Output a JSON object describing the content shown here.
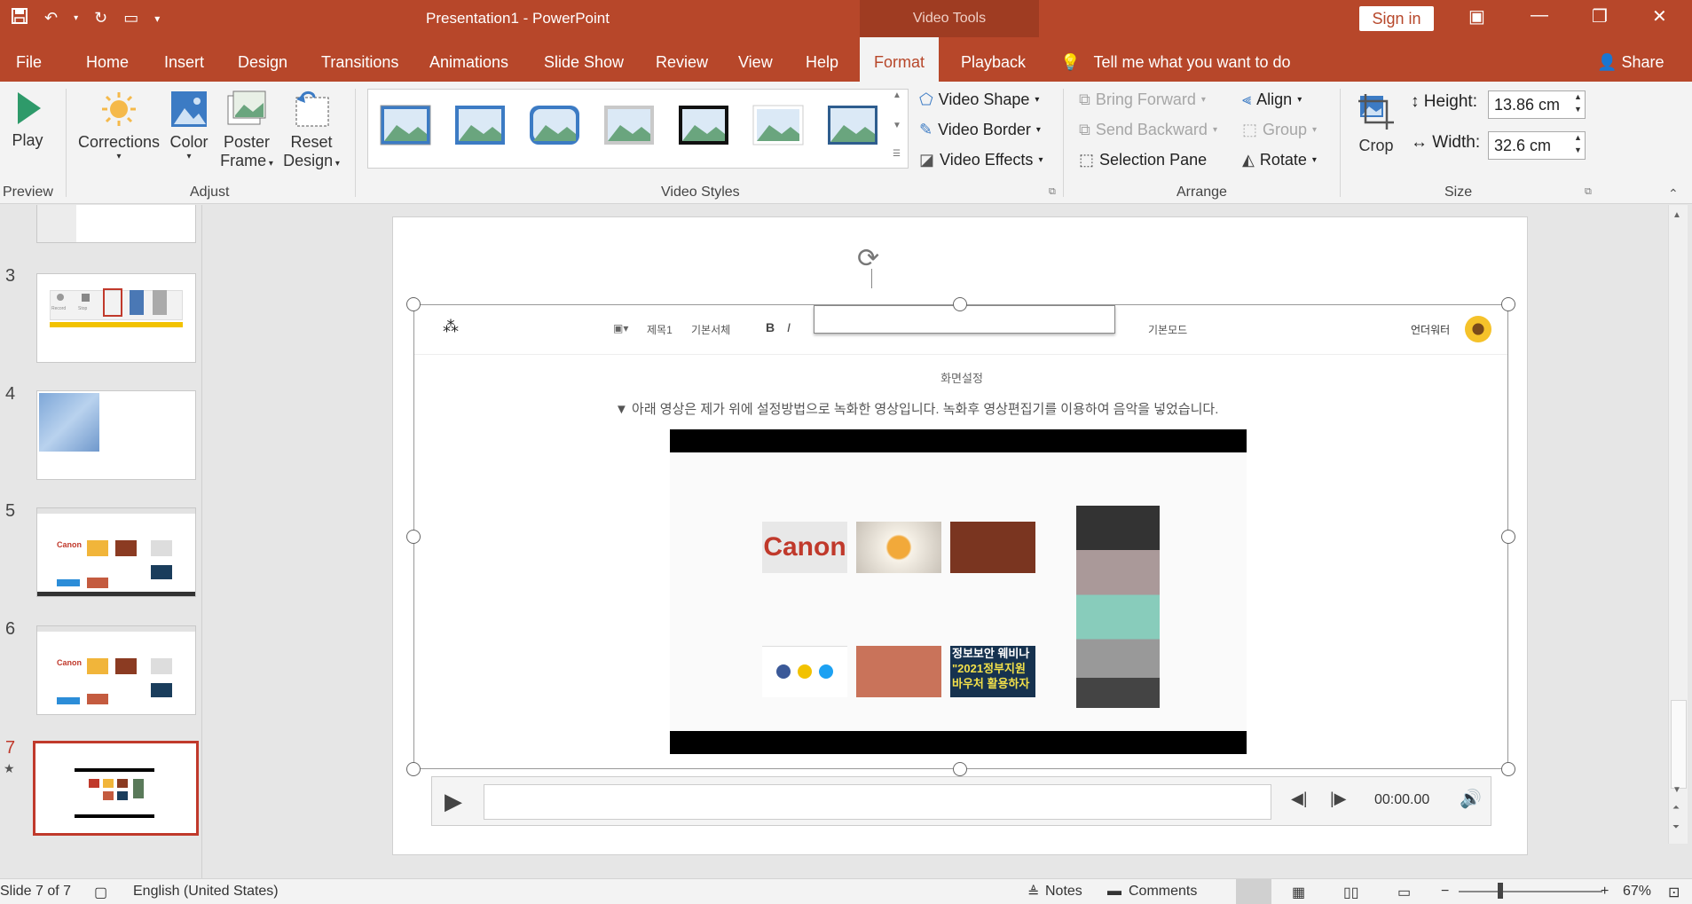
{
  "window": {
    "title": "Presentation1  -  PowerPoint",
    "context_tab_group": "Video Tools",
    "sign_in_label": "Sign in"
  },
  "tabs": [
    "File",
    "Home",
    "Insert",
    "Design",
    "Transitions",
    "Animations",
    "Slide Show",
    "Review",
    "View",
    "Help",
    "Format",
    "Playback"
  ],
  "active_tab": "Format",
  "tell_me": "Tell me what you want to do",
  "share_label": "Share",
  "ribbon": {
    "preview": {
      "play_label": "Play",
      "group_label": "Preview"
    },
    "adjust": {
      "corrections_label": "Corrections",
      "color_label": "Color",
      "poster_frame_line1": "Poster",
      "poster_frame_line2": "Frame",
      "reset_design_line1": "Reset",
      "reset_design_line2": "Design",
      "group_label": "Adjust"
    },
    "video_styles": {
      "video_shape_label": "Video Shape",
      "video_border_label": "Video Border",
      "video_effects_label": "Video Effects",
      "group_label": "Video Styles"
    },
    "arrange": {
      "bring_forward_label": "Bring Forward",
      "send_backward_label": "Send Backward",
      "selection_pane_label": "Selection Pane",
      "align_label": "Align",
      "group_btn_label": "Group",
      "rotate_label": "Rotate",
      "group_label": "Arrange"
    },
    "size": {
      "crop_label": "Crop",
      "height_label": "Height:",
      "height_value": "13.86 cm",
      "width_label": "Width:",
      "width_value": "32.6 cm",
      "group_label": "Size"
    }
  },
  "thumbnails": [
    {
      "number": "3",
      "caption_a": "Record",
      "caption_b": "Stop"
    },
    {
      "number": "4"
    },
    {
      "number": "5",
      "brand": "Canon"
    },
    {
      "number": "6",
      "brand": "Canon"
    },
    {
      "number": "7",
      "star": "★"
    }
  ],
  "slide_content": {
    "toolbar_items": [
      "제목1",
      "기본서체",
      "기본모드",
      "언더워터"
    ],
    "heading": "화면설정",
    "caption": "▼ 아래 영상은 제가 위에 설정방법으로 녹화한 영상입니다. 녹화후 영상편집기를 이용하여 음악을 넣었습니다.",
    "video_tiles": [
      "Canon",
      "정보보안 웨비나",
      "\"2021정부지원",
      "바우처 활용하자"
    ]
  },
  "player": {
    "time": "00:00.00"
  },
  "status": {
    "slide_info": "Slide 7 of 7",
    "language": "English (United States)",
    "notes_label": "Notes",
    "comments_label": "Comments",
    "zoom": "67%"
  },
  "colors": {
    "accent": "#b7472a"
  }
}
